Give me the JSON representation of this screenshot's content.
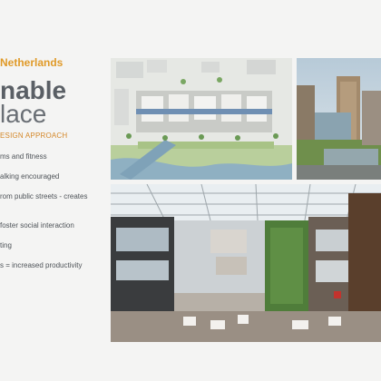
{
  "slide": {
    "subtitle": "Netherlands",
    "title_line1": "nable",
    "title_line2": "lace",
    "section_heading": "ESIGN APPROACH",
    "bullets": [
      "ms and fitness",
      "alking encouraged",
      "rom public streets - creates",
      "foster social interaction",
      "ting",
      "s = increased productivity"
    ]
  },
  "images": {
    "site_plan": "site-plan-rendering",
    "tower_exterior": "building-tower-photo",
    "atrium": "atrium-interior-photo"
  }
}
